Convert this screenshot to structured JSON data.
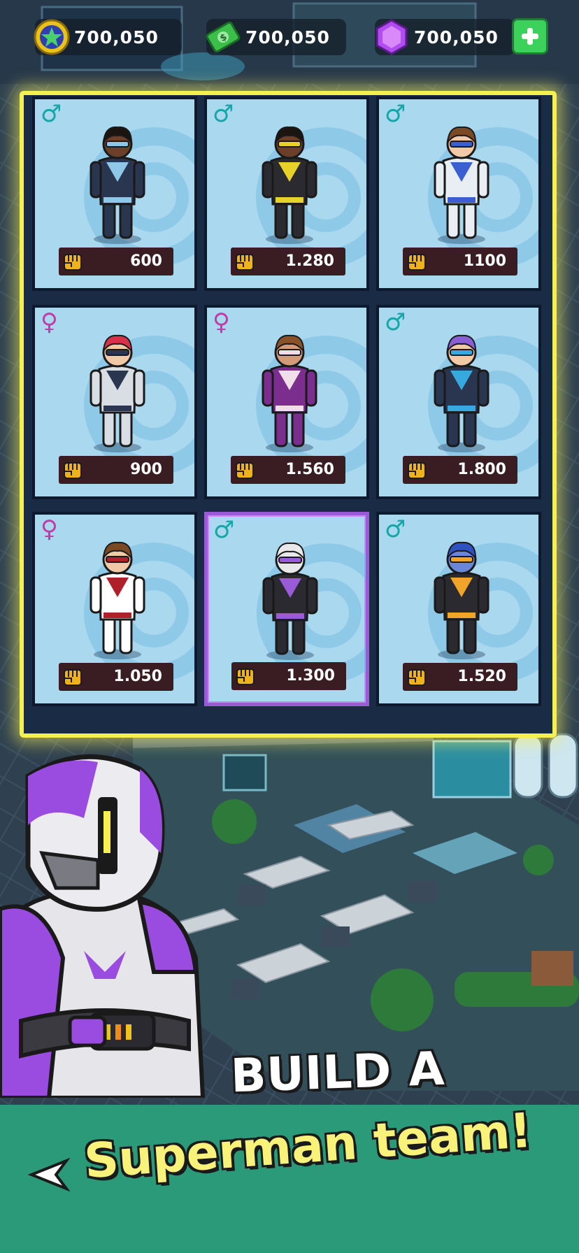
{
  "currencies": [
    {
      "name": "star-coin",
      "value": "700,050",
      "color": "#2f3fb0"
    },
    {
      "name": "cash",
      "value": "700,050",
      "color": "#3bbf4a"
    },
    {
      "name": "gem",
      "value": "700,050",
      "color": "#b04cf0"
    }
  ],
  "heroes": [
    {
      "gender": "♂",
      "gender_type": "male",
      "power": "600",
      "suit": "#2a3550",
      "accent": "#8fc7e8",
      "hair": "#1c1410",
      "skin": "#6b3f28",
      "selected": false
    },
    {
      "gender": "♂",
      "gender_type": "male",
      "power": "1.280",
      "suit": "#2a2a30",
      "accent": "#e8d22a",
      "hair": "#1c1410",
      "skin": "#6b3f28",
      "selected": false
    },
    {
      "gender": "♂",
      "gender_type": "male",
      "power": "1100",
      "suit": "#e8eef4",
      "accent": "#3a5fd0",
      "hair": "#7a4a25",
      "skin": "#f1c9a6",
      "selected": false
    },
    {
      "gender": "♀",
      "gender_type": "female",
      "power": "900",
      "suit": "#d9dde4",
      "accent": "#2a3550",
      "hair": "#d6324a",
      "skin": "#f1c9a6",
      "selected": false
    },
    {
      "gender": "♀",
      "gender_type": "female",
      "power": "1.560",
      "suit": "#7b2e8e",
      "accent": "#f0dfe8",
      "hair": "#8a5228",
      "skin": "#d49b78",
      "selected": false
    },
    {
      "gender": "♂",
      "gender_type": "male",
      "power": "1.800",
      "suit": "#2a3550",
      "accent": "#38a8e0",
      "hair": "#8a5fd6",
      "skin": "#f1c9a6",
      "selected": false
    },
    {
      "gender": "♀",
      "gender_type": "female",
      "power": "1.050",
      "suit": "#ffffff",
      "accent": "#b0202a",
      "hair": "#7a4a25",
      "skin": "#f1c9a6",
      "selected": false
    },
    {
      "gender": "♂",
      "gender_type": "male",
      "power": "1.300",
      "suit": "#2a2a30",
      "accent": "#9a5bd8",
      "hair": "#e8e8ea",
      "skin": "#e8e8ea",
      "selected": true
    },
    {
      "gender": "♂",
      "gender_type": "male",
      "power": "1.520",
      "suit": "#2a2a30",
      "accent": "#f0a428",
      "hair": "#2f52c0",
      "skin": "#6a86d8",
      "selected": false
    }
  ],
  "promo": {
    "line1": "BUILD A",
    "line2": "Superman team!"
  }
}
